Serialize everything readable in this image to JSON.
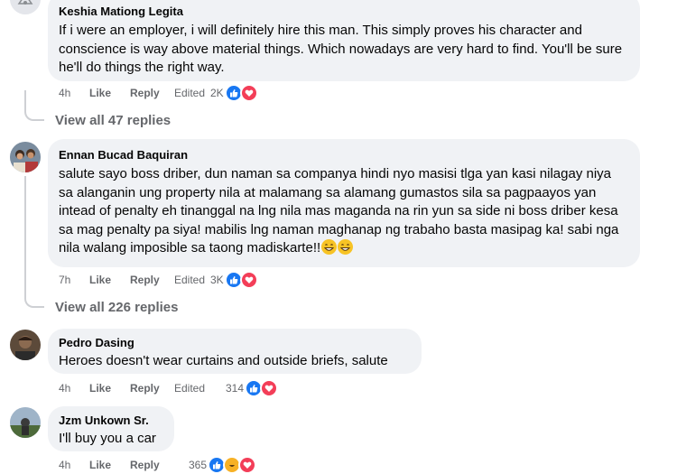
{
  "comments": [
    {
      "author": "Keshia Mationg Legita",
      "text": "If i were an employer, i will definitely hire this man. This simply proves his character and conscience is way above material things. Which nowadays are very hard to find. You'll be sure he'll do things the right way.",
      "time": "4h",
      "like": "Like",
      "reply": "Reply",
      "edited": "Edited",
      "reaction_count": "2K",
      "reactions": [
        "like-icon",
        "love-icon"
      ],
      "view_replies": "View all 47 replies"
    },
    {
      "author": "Ennan Bucad Baquiran",
      "text": "salute sayo boss driber, dun naman sa companya hindi nyo masisi tlga yan kasi nilagay niya sa alanganin ung property nila at malamang sa alamang gumastos sila sa pagpaayos yan intead of penalty eh tinanggal na lng nila mas maganda na rin yun sa side ni boss driber kesa sa mag penalty pa siya! mabilis lng naman maghanap ng trabaho basta masipag ka! sabi nga nila walang imposible sa taong madiskarte!!",
      "time": "7h",
      "like": "Like",
      "reply": "Reply",
      "edited": "Edited",
      "reaction_count": "3K",
      "reactions": [
        "like-icon",
        "love-icon"
      ],
      "view_replies": "View all 226 replies"
    },
    {
      "author": "Pedro Dasing",
      "text": "Heroes doesn't wear curtains and outside briefs, salute",
      "time": "4h",
      "like": "Like",
      "reply": "Reply",
      "edited": "Edited",
      "reaction_count": "314",
      "reactions": [
        "like-icon",
        "love-icon"
      ]
    },
    {
      "author": "Jzm Unkown Sr.",
      "text": "I'll buy you a car",
      "time": "4h",
      "like": "Like",
      "reply": "Reply",
      "reaction_count": "365",
      "reactions": [
        "like-icon",
        "haha-icon",
        "love-icon"
      ]
    }
  ],
  "colors": {
    "bubble": "#f0f2f5",
    "meta": "#65676b",
    "like_blue": "#1877f2",
    "love_red": "#f33e58",
    "haha_yellow": "#f7b125"
  }
}
